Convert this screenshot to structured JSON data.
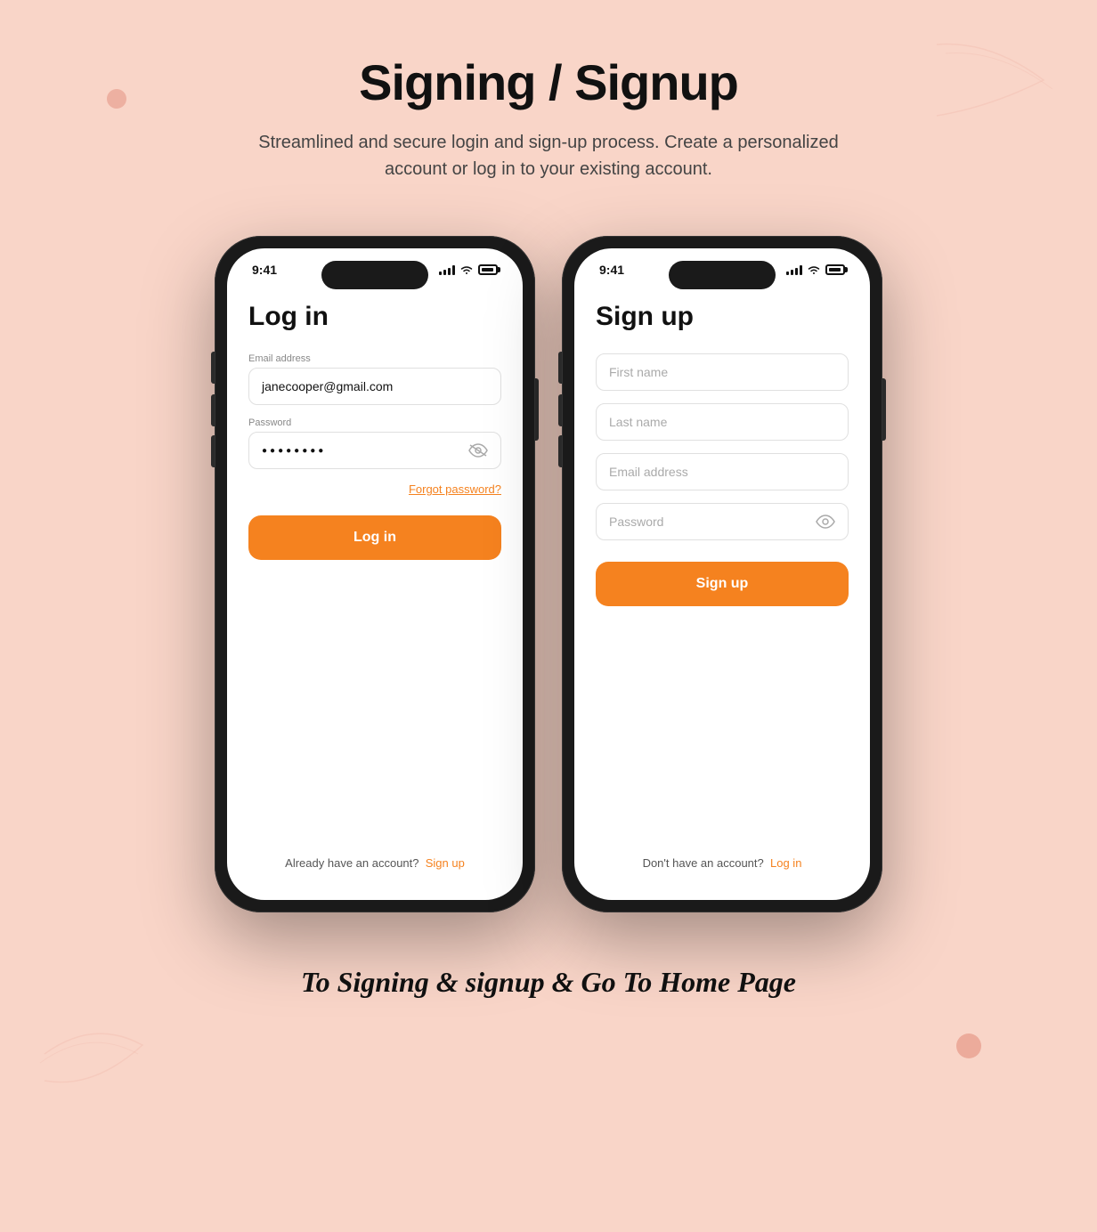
{
  "page": {
    "title": "Signing / Signup",
    "subtitle": "Streamlined and secure login and sign-up process. Create a personalized account or log in to your existing account.",
    "bottom_caption": "To Signing & signup & Go To Home Page",
    "background_color": "#f9d5c8",
    "accent_color": "#F5821F"
  },
  "login_phone": {
    "status_time": "9:41",
    "screen_title": "Log in",
    "email_label": "Email address",
    "email_value": "janecooper@gmail.com",
    "password_label": "Password",
    "password_dots": "●●●●●●●●",
    "forgot_label": "Forgot password?",
    "button_label": "Log in",
    "footer_text": "Already have an account?",
    "footer_link": "Sign up"
  },
  "signup_phone": {
    "status_time": "9:41",
    "screen_title": "Sign up",
    "first_name_placeholder": "First name",
    "last_name_placeholder": "Last name",
    "email_placeholder": "Email address",
    "password_placeholder": "Password",
    "button_label": "Sign up",
    "footer_text": "Don't have an account?",
    "footer_link": "Log in"
  }
}
